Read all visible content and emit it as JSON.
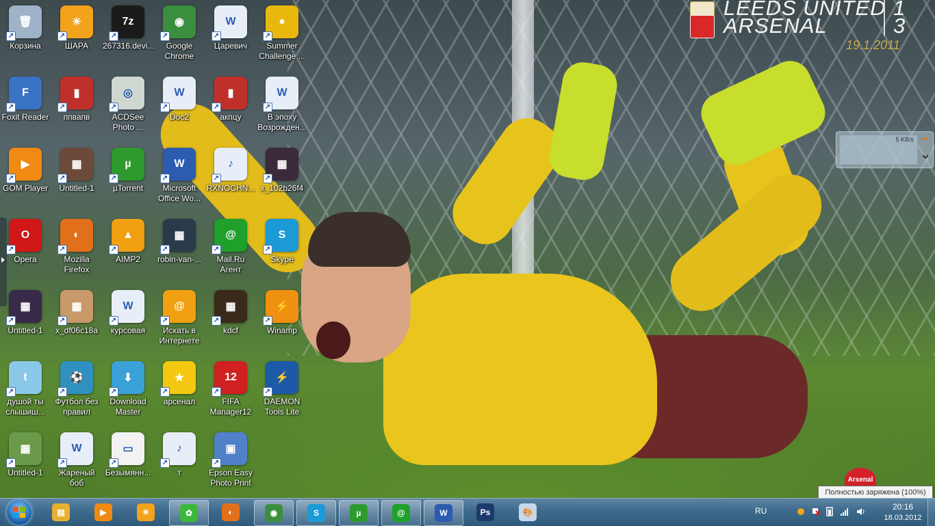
{
  "desktop_icons": [
    {
      "label": "Корзина",
      "icon": "recycle-bin-icon",
      "color": "#9fb3c8",
      "glyph": "🗑"
    },
    {
      "label": "ШАРА",
      "icon": "sun-folder-icon",
      "color": "#f2a21b",
      "glyph": "☀"
    },
    {
      "label": "267316.devi...",
      "icon": "7z-sfx-icon",
      "color": "#1b1b1b",
      "glyph": "7z"
    },
    {
      "label": "Google Chrome",
      "icon": "chrome-icon",
      "color": "#3b8e3e",
      "glyph": "◉"
    },
    {
      "label": "Царевич",
      "icon": "word-doc-icon",
      "color": "#e8eef8",
      "glyph": "W"
    },
    {
      "label": "Summer Challenge ...",
      "icon": "coin-icon",
      "color": "#e8b80c",
      "glyph": "●"
    },
    {
      "label": "Foxit Reader",
      "icon": "foxit-icon",
      "color": "#3a72c4",
      "glyph": "F"
    },
    {
      "label": "ппвапв",
      "icon": "image-icon",
      "color": "#c0302a",
      "glyph": "▮"
    },
    {
      "label": "ACDSee Photo ...",
      "icon": "acdsee-icon",
      "color": "#cfd8d0",
      "glyph": "◎"
    },
    {
      "label": "Doc2",
      "icon": "word-doc-icon",
      "color": "#e8eef8",
      "glyph": "W"
    },
    {
      "label": "акпцу",
      "icon": "image-icon",
      "color": "#c0302a",
      "glyph": "▮"
    },
    {
      "label": "В эпоху Возрожден...",
      "icon": "word-doc-icon",
      "color": "#e8eef8",
      "glyph": "W"
    },
    {
      "label": "GOM Player",
      "icon": "gom-player-icon",
      "color": "#f08a12",
      "glyph": "▶"
    },
    {
      "label": "Untitled-1",
      "icon": "photo-icon",
      "color": "#6b4a3a",
      "glyph": "▦"
    },
    {
      "label": "µTorrent",
      "icon": "utorrent-icon",
      "color": "#2e9a2e",
      "glyph": "µ"
    },
    {
      "label": "Microsoft Office Wo...",
      "icon": "msword-icon",
      "color": "#2b5cb0",
      "glyph": "W"
    },
    {
      "label": "RXNOCHN...",
      "icon": "mp3-icon",
      "color": "#e8eef8",
      "glyph": "♪"
    },
    {
      "label": "x_102b26f4",
      "icon": "photo-icon",
      "color": "#3a2a3a",
      "glyph": "▦"
    },
    {
      "label": "Opera",
      "icon": "opera-icon",
      "color": "#d01818",
      "glyph": "O"
    },
    {
      "label": "Mozilla Firefox",
      "icon": "firefox-icon",
      "color": "#e2701a",
      "glyph": "◐"
    },
    {
      "label": "AIMP2",
      "icon": "aimp-icon",
      "color": "#f0a010",
      "glyph": "▲"
    },
    {
      "label": "robin-van-...",
      "icon": "photo-icon",
      "color": "#2a3a4a",
      "glyph": "▦"
    },
    {
      "label": "Mail.Ru Агент",
      "icon": "mailru-agent-icon",
      "color": "#1fa02a",
      "glyph": "@"
    },
    {
      "label": "Skype",
      "icon": "skype-icon",
      "color": "#1c9ad6",
      "glyph": "S"
    },
    {
      "label": "Untitled-1",
      "icon": "photo-icon",
      "color": "#3a2a4a",
      "glyph": "▦"
    },
    {
      "label": "x_df06c18a",
      "icon": "photo-icon",
      "color": "#c89a6a",
      "glyph": "▦"
    },
    {
      "label": "курсовая",
      "icon": "word-doc-icon",
      "color": "#e8eef8",
      "glyph": "W"
    },
    {
      "label": "Искать в Интернете",
      "icon": "search-web-icon",
      "color": "#f0a010",
      "glyph": "@"
    },
    {
      "label": "kdcf",
      "icon": "photo-icon",
      "color": "#3a2a1a",
      "glyph": "▦"
    },
    {
      "label": "Winamp",
      "icon": "winamp-icon",
      "color": "#f09010",
      "glyph": "⚡"
    },
    {
      "label": "душой ты слышиш...",
      "icon": "twitter-icon",
      "color": "#8ac8e8",
      "glyph": "t"
    },
    {
      "label": "Футбол без правил",
      "icon": "game-icon",
      "color": "#3090c0",
      "glyph": "⚽"
    },
    {
      "label": "Download Master",
      "icon": "download-master-icon",
      "color": "#3aa0d8",
      "glyph": "⬇"
    },
    {
      "label": "арсенал",
      "icon": "star-icon",
      "color": "#f4c810",
      "glyph": "★"
    },
    {
      "label": "FIFA Manager12",
      "icon": "fifa-manager-icon",
      "color": "#d02020",
      "glyph": "12"
    },
    {
      "label": "DAEMON Tools Lite",
      "icon": "daemon-tools-icon",
      "color": "#1c5aa8",
      "glyph": "⚡"
    },
    {
      "label": "Untitled-1",
      "icon": "photo-icon",
      "color": "#6a9a4a",
      "glyph": "▦"
    },
    {
      "label": "Жареный боб",
      "icon": "word-doc-icon",
      "color": "#e8eef8",
      "glyph": "W"
    },
    {
      "label": "Безымянн...",
      "icon": "image-icon",
      "color": "#f2f2f2",
      "glyph": "▭"
    },
    {
      "label": "т",
      "icon": "mp3-icon",
      "color": "#e8eef8",
      "glyph": "♪"
    },
    {
      "label": "Epson Easy Photo Print",
      "icon": "epson-icon",
      "color": "#5080c8",
      "glyph": "▣"
    }
  ],
  "scoreboard": {
    "team1": "LEEDS UNITED",
    "team2": "ARSENAL",
    "score1": "1",
    "score2": "3",
    "date": "19.1.2011"
  },
  "gadget": {
    "rate": "5 KB/s"
  },
  "crest_text": "Arsenal",
  "tooltip": "Полностью заряжена (100%)",
  "taskbar": {
    "items": [
      {
        "icon": "explorer-icon",
        "color": "#e8b030",
        "glyph": "▤",
        "active": false
      },
      {
        "icon": "media-player-icon",
        "color": "#f08a12",
        "glyph": "▶",
        "active": false
      },
      {
        "icon": "sun-folder-icon",
        "color": "#f2a21b",
        "glyph": "☀",
        "active": false
      },
      {
        "icon": "icq-icon",
        "color": "#3cb83c",
        "glyph": "✿",
        "active": true
      },
      {
        "icon": "firefox-icon",
        "color": "#e2701a",
        "glyph": "◐",
        "active": false
      },
      {
        "icon": "chrome-icon",
        "color": "#3b8e3e",
        "glyph": "◉",
        "active": true
      },
      {
        "icon": "skype-icon",
        "color": "#1c9ad6",
        "glyph": "S",
        "active": true
      },
      {
        "icon": "utorrent-icon",
        "color": "#2e9a2e",
        "glyph": "µ",
        "active": true
      },
      {
        "icon": "mailru-agent-icon",
        "color": "#1fa02a",
        "glyph": "@",
        "active": true
      },
      {
        "icon": "msword-icon",
        "color": "#2b5cb0",
        "glyph": "W",
        "active": true
      },
      {
        "icon": "photoshop-icon",
        "color": "#1c3a6a",
        "glyph": "Ps",
        "active": false
      },
      {
        "icon": "paint-icon",
        "color": "#c8d8e8",
        "glyph": "🎨",
        "active": false
      }
    ],
    "tray": {
      "lang": "RU",
      "time": "20:16",
      "date": "18.03.2012"
    }
  }
}
